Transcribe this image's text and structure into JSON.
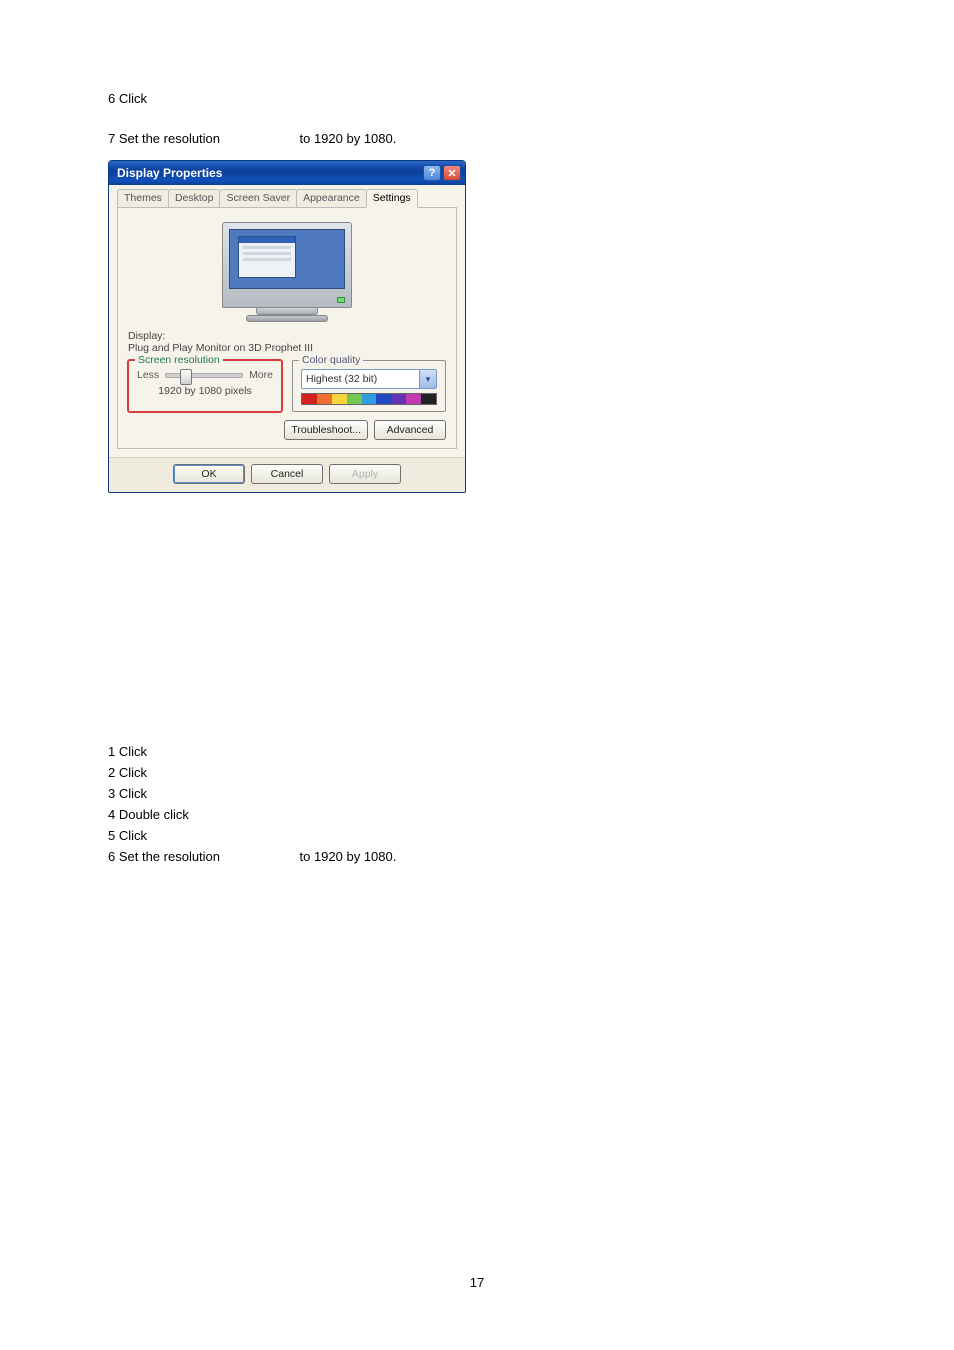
{
  "top": {
    "line1": "6 Click",
    "gap": " ",
    "line2a": "7 Set the resolution",
    "line2b": "to 1920 by 1080."
  },
  "dialog": {
    "title": "Display Properties",
    "help": "?",
    "close": "✕",
    "tabs": {
      "themes": "Themes",
      "desktop": "Desktop",
      "screensaver": "Screen Saver",
      "appearance": "Appearance",
      "settings": "Settings"
    },
    "display_label": "Display:",
    "display_text": "Plug and Play Monitor on 3D Prophet III",
    "res_group": "Screen resolution",
    "less": "Less",
    "more": "More",
    "res_readout": "1920 by 1080 pixels",
    "color_group": "Color quality",
    "color_value": "Highest (32 bit)",
    "troubleshoot": "Troubleshoot...",
    "advanced": "Advanced",
    "ok": "OK",
    "cancel": "Cancel",
    "apply": "Apply"
  },
  "color_strip": [
    "#d61f1f",
    "#f07030",
    "#f5d53a",
    "#74c850",
    "#2f9ee0",
    "#2349c2",
    "#6332b5",
    "#c23ab0",
    "#222222"
  ],
  "steps": {
    "s1": "1 Click",
    "s2": "2 Click",
    "s3": "3 Click",
    "s4": "4 Double click",
    "s5": "5 Click",
    "s6a": "6 Set the resolution",
    "s6b": "to 1920 by 1080."
  },
  "page_number": "17"
}
